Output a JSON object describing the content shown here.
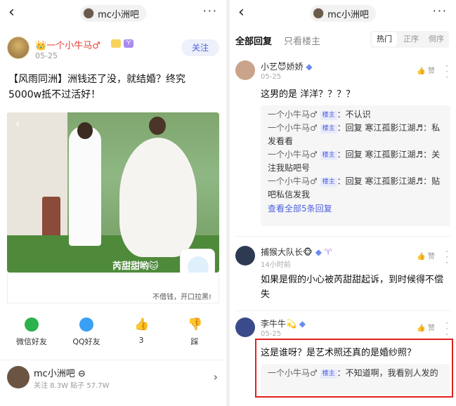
{
  "left": {
    "back_icon": "chevron-left-icon",
    "forum_title": "mc小洲吧",
    "more_icon": "more-horizontal-icon",
    "author": {
      "prefix": "👑",
      "name": "一个小牛马♂",
      "date": "05-25",
      "follow_label": "关注"
    },
    "post_text": "【风雨同洲】洲钱还了没，就结婚？终究5000w抵不过活好！",
    "image": {
      "watermark": "芮甜甜哟🐱",
      "caption": "不借钱，开口拉黑!"
    },
    "share": [
      {
        "label": "微信好友",
        "icon": "wechat-icon",
        "color": "#2bb24c"
      },
      {
        "label": "QQ好友",
        "icon": "qq-icon",
        "color": "#3aa0f5"
      },
      {
        "label": "3",
        "icon": "thumbs-up-icon",
        "color": "#333333"
      },
      {
        "label": "踩",
        "icon": "thumbs-down-icon",
        "color": "#333333"
      }
    ],
    "forum_card": {
      "name": "mc小洲吧 ⊖",
      "stats": "关注 8.3W   贴子 57.7W"
    }
  },
  "right": {
    "forum_title": "mc小洲吧",
    "tabs": {
      "all": "全部回复",
      "op_only": "只看楼主"
    },
    "sort": [
      "热门",
      "正序",
      "倒序"
    ],
    "comments": [
      {
        "name": "小艺😈娇娇",
        "meta": "05-25",
        "like": "赞",
        "text": "这男的是 洋洋？？？？",
        "replies": [
          {
            "name": "一个小牛马♂",
            "tag": "楼主",
            "text": "：不认识"
          },
          {
            "name": "一个小牛马♂",
            "tag": "楼主",
            "text": "：回复 寒江孤影江湖♬：私发看看"
          },
          {
            "name": "一个小牛马♂",
            "tag": "楼主",
            "text": "：回复 寒江孤影江湖♬：关注我贴吧号"
          },
          {
            "name": "一个小牛马♂",
            "tag": "楼主",
            "text": "：回复 寒江孤影江湖♬：贴吧私信发我"
          }
        ],
        "more": "查看全部5条回复"
      },
      {
        "name": "捕猴大队长🐵",
        "meta": "14小时前",
        "like": "赞",
        "text": "如果是假的小心被芮甜甜起诉，到时候得不偿失"
      },
      {
        "name": "李牛牛💫",
        "meta": "05-25",
        "like": "赞",
        "text": "这是谁呀？是艺术照还真的是婚纱照？",
        "replies": [
          {
            "name": "一个小牛马♂",
            "tag": "楼主",
            "text": "：不知道啊，我看别人发的"
          }
        ]
      }
    ]
  }
}
